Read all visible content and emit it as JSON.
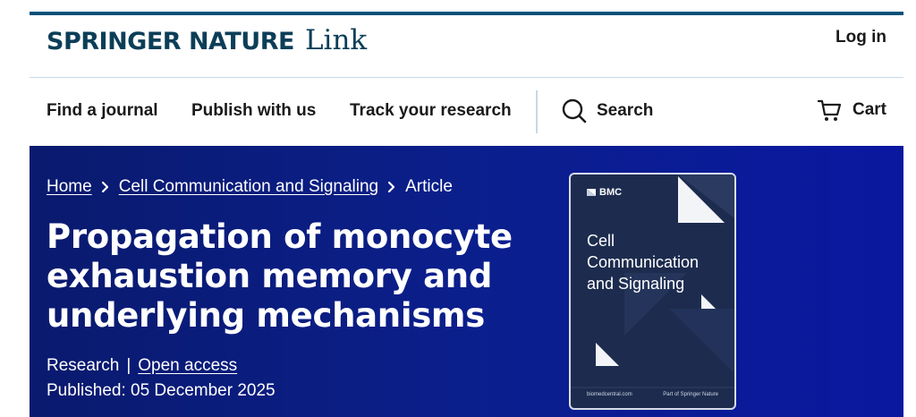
{
  "header": {
    "brand": "SPRINGER NATURE",
    "product": "Link",
    "login_label": "Log in"
  },
  "nav": {
    "items": [
      {
        "label": "Find a journal"
      },
      {
        "label": "Publish with us"
      },
      {
        "label": "Track your research"
      }
    ],
    "search_label": "Search",
    "cart_label": "Cart"
  },
  "breadcrumb": {
    "home": "Home",
    "journal": "Cell Communication and Signaling",
    "current": "Article"
  },
  "article": {
    "title": "Propagation of monocyte exhaustion memory and underlying mechanisms",
    "type": "Research",
    "divider": "|",
    "access": "Open access",
    "published": "Published: 05 December 2025"
  },
  "cover": {
    "publisher": "BMC",
    "title": "Cell Communication and Signaling",
    "footer_left": "biomedcentral.com",
    "footer_right": "Part of Springer Nature"
  },
  "colors": {
    "brand": "#0c3e58",
    "top_rule": "#04507a",
    "hero_background": "#0b1f8c",
    "cover_background": "#1d2c4e"
  },
  "icons": {
    "search": "search-icon",
    "cart": "cart-icon",
    "breadcrumb_separator": "chevron-right-icon",
    "publisher_logo": "bmc-logo-icon"
  }
}
